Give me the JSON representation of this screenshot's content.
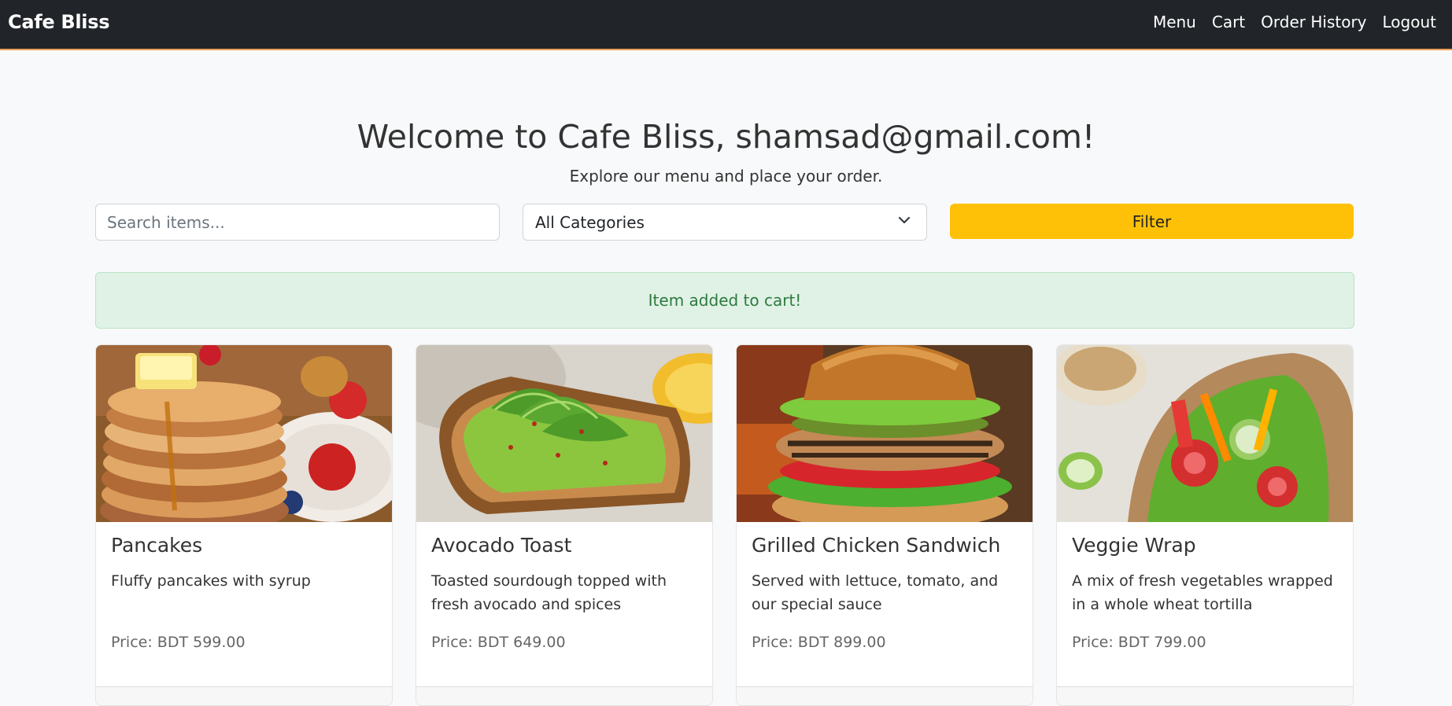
{
  "navbar": {
    "brand": "Cafe Bliss",
    "links": [
      "Menu",
      "Cart",
      "Order History",
      "Logout"
    ]
  },
  "main": {
    "heading": "Welcome to Cafe Bliss, shamsad@gmail.com!",
    "subheading": "Explore our menu and place your order."
  },
  "filters": {
    "search_placeholder": "Search items...",
    "category_selected": "All Categories",
    "filter_label": "Filter"
  },
  "alert": {
    "message": "Item added to cart!"
  },
  "items": [
    {
      "name": "Pancakes",
      "description": "Fluffy pancakes with syrup",
      "price": "Price: BDT 599.00"
    },
    {
      "name": "Avocado Toast",
      "description": "Toasted sourdough topped with fresh avocado and spices",
      "price": "Price: BDT 649.00"
    },
    {
      "name": "Grilled Chicken Sandwich",
      "description": "Served with lettuce, tomato, and our special sauce",
      "price": "Price: BDT 899.00"
    },
    {
      "name": "Veggie Wrap",
      "description": "A mix of fresh vegetables wrapped in a whole wheat tortilla",
      "price": "Price: BDT 799.00"
    }
  ],
  "colors": {
    "navbar_bg": "#212529",
    "accent": "#ffc107",
    "alert_bg": "#e0f2e6",
    "alert_text": "#2d7a3e"
  }
}
